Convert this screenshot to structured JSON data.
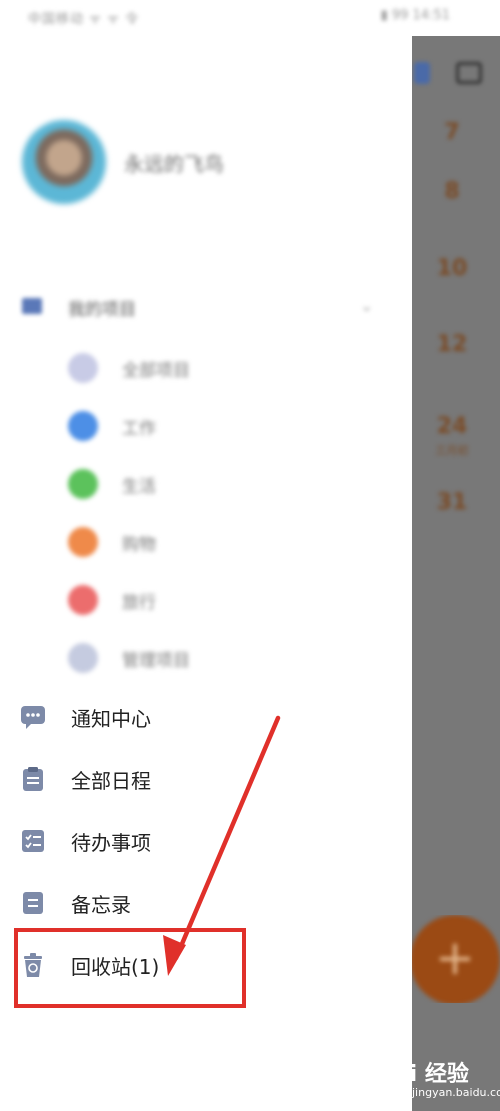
{
  "status_bar": {
    "left": "中国移动 ᯤ ᯤ 令",
    "right": "▮ 99 14:51"
  },
  "drawer": {
    "user": {
      "name": "永远的飞鸟"
    },
    "projects": {
      "header": "我的项目",
      "items": [
        {
          "label": "全部项目",
          "color": "#c8cbe6"
        },
        {
          "label": "工作",
          "color": "#4d8fe6"
        },
        {
          "label": "生活",
          "color": "#5cc25c"
        },
        {
          "label": "购物",
          "color": "#ef8a4a"
        },
        {
          "label": "旅行",
          "color": "#ec6d6d"
        },
        {
          "label": "管理项目",
          "color": "#c5cbe0"
        }
      ]
    },
    "menu": [
      {
        "label": "通知中心",
        "icon": "chat-icon"
      },
      {
        "label": "全部日程",
        "icon": "clipboard-icon"
      },
      {
        "label": "待办事项",
        "icon": "checklist-icon"
      },
      {
        "label": "备忘录",
        "icon": "memo-icon"
      },
      {
        "label": "回收站(1)",
        "icon": "trash-icon"
      }
    ]
  },
  "calendar": {
    "days": [
      "7",
      "8",
      "10",
      "12",
      "24",
      "31"
    ],
    "sub": "三月初",
    "fab": "+"
  },
  "watermark": {
    "main": "Bai  经验",
    "url": "jingyan.baidu.com"
  },
  "colors": {
    "accent": "#5a78b8",
    "highlight": "#e0302a",
    "menu_icon": "#7d8aa8"
  }
}
